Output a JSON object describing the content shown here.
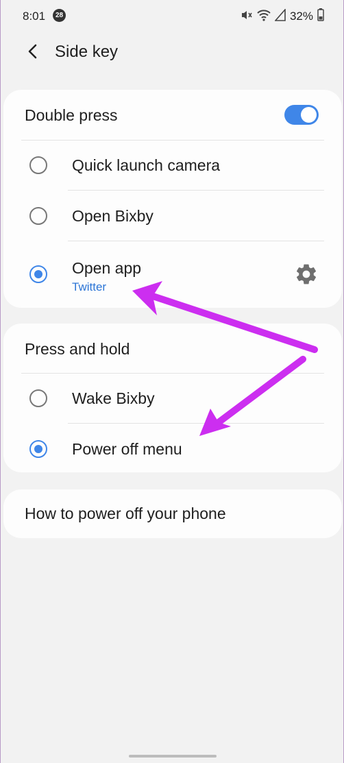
{
  "status_bar": {
    "time": "8:01",
    "notification_count": "28",
    "battery": "32%",
    "icons": [
      "mute-icon",
      "wifi-icon",
      "signal-icon",
      "battery-icon"
    ]
  },
  "header": {
    "back_icon": "back-arrow-icon",
    "title": "Side key"
  },
  "double_press": {
    "label": "Double press",
    "toggle_on": true,
    "options": [
      {
        "label": "Quick launch camera",
        "selected": false
      },
      {
        "label": "Open Bixby",
        "selected": false
      },
      {
        "label": "Open app",
        "sublabel": "Twitter",
        "selected": true,
        "icon": "gear-icon"
      }
    ]
  },
  "press_and_hold": {
    "label": "Press and hold",
    "options": [
      {
        "label": "Wake Bixby",
        "selected": false
      },
      {
        "label": "Power off menu",
        "selected": true
      }
    ]
  },
  "help": {
    "label": "How to power off your phone"
  },
  "colors": {
    "accent": "#3f86e8",
    "link": "#2c75d6",
    "annotation_arrow": "#cc2ef0",
    "background": "#f2f2f2",
    "card": "#fdfdfd"
  }
}
